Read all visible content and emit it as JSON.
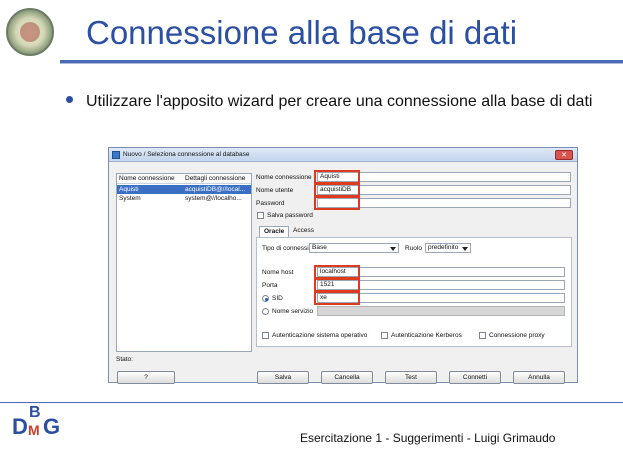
{
  "slide": {
    "title": "Connessione alla base di dati",
    "bullet": "Utilizzare l'apposito wizard per creare una connessione alla base di dati",
    "footer": "Esercitazione 1 - Suggerimenti - Luigi Grimaudo",
    "logo_letters": {
      "d": "D",
      "b": "B",
      "m": "M",
      "g": "G"
    }
  },
  "dialog": {
    "title": "Nuovo / Seleziona connessione al database",
    "list": {
      "headers": [
        "Nome connessione",
        "Dettagli connessione"
      ],
      "rows": [
        {
          "name": "Aquisti",
          "details": "acquistiDB@//local..."
        },
        {
          "name": "System",
          "details": "system@//localho..."
        }
      ]
    },
    "fields": {
      "nome_connessione_label": "Nome connessione",
      "nome_connessione_value": "Aquisti",
      "nome_utente_label": "Nome utente",
      "nome_utente_value": "acquistiDB",
      "password_label": "Password",
      "password_value": "",
      "salva_password_label": "Salva password"
    },
    "tabs": [
      "Oracle",
      "Access"
    ],
    "oracle": {
      "tipo_label": "Tipo di connessione",
      "tipo_value": "Base",
      "ruolo_label": "Ruolo",
      "ruolo_value": "predefinito",
      "host_label": "Nome host",
      "host_value": "localhost",
      "porta_label": "Porta",
      "porta_value": "1521",
      "sid_label": "SID",
      "sid_value": "xe",
      "servizio_label": "Nome servizio",
      "auth_so": "Autenticazione sistema operativo",
      "auth_kerberos": "Autenticazione Kerberos",
      "proxy": "Connessione proxy"
    },
    "status_label": "Stato:",
    "buttons": {
      "help": "?",
      "salva": "Salva",
      "cancella": "Cancella",
      "test": "Test",
      "connetti": "Connetti",
      "annulla": "Annulla"
    },
    "highlight_color": "#e03a1e"
  },
  "colors": {
    "accent": "#2b4fa3",
    "selected_row": "#3a6fc4"
  }
}
